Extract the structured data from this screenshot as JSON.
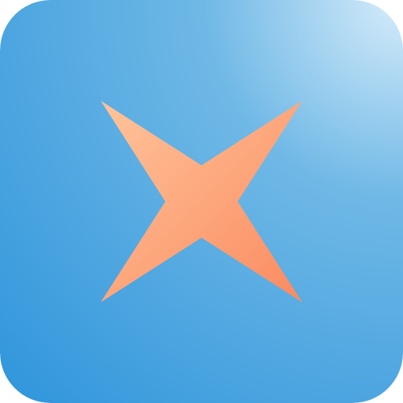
{
  "app_icon": {
    "icon": "four-pointed-star-icon",
    "colors": {
      "background_light": "#d6ecfa",
      "background_mid": "#6fb8e6",
      "background_dark": "#2f95db",
      "star_light": "#ffc49a",
      "star_dark": "#fb8a60"
    }
  }
}
